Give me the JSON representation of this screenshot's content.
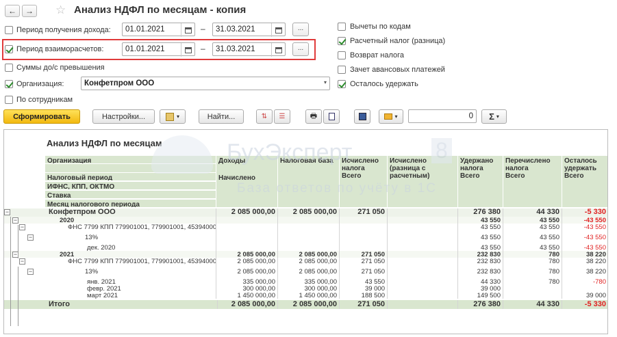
{
  "window": {
    "title": "Анализ НДФЛ по месяцам - копия",
    "back_icon": "←",
    "forward_icon": "→",
    "star_icon": "☆"
  },
  "filters": {
    "income_period": {
      "label": "Период получения дохода:",
      "checked": false,
      "from": "01.01.2021",
      "to": "31.03.2021"
    },
    "settlement_period": {
      "label": "Период взаиморасчетов:",
      "checked": true,
      "from": "01.01.2021",
      "to": "31.03.2021"
    },
    "sums_exceeding": {
      "label": "Суммы до/с превышения",
      "checked": false
    },
    "organization": {
      "label": "Организация:",
      "checked": true,
      "value": "Конфетпром ООО"
    },
    "by_employees": {
      "label": "По сотрудникам",
      "checked": false
    },
    "dash": "–",
    "dots": "..."
  },
  "options": [
    {
      "label": "Вычеты по кодам",
      "checked": false
    },
    {
      "label": "Расчетный налог (разница)",
      "checked": true
    },
    {
      "label": "Возврат налога",
      "checked": false
    },
    {
      "label": "Зачет авансовых платежей",
      "checked": false
    },
    {
      "label": "Осталось удержать",
      "checked": true
    }
  ],
  "toolbar": {
    "generate": "Сформировать",
    "settings": "Настройки...",
    "find": "Найти...",
    "sum_value": "0",
    "sigma": "Σ"
  },
  "watermark": {
    "brand": "БухЭксперт",
    "num": "8",
    "sub": "База ответов по учёту в 1С"
  },
  "report": {
    "title": "Анализ НДФЛ по месяцам",
    "headers": {
      "org": "Организация",
      "period": "Налоговый период",
      "ifns": "ИФНС, КПП, ОКТМО",
      "rate": "Ставка",
      "month": "Месяц налогового периода",
      "income": "Доходы",
      "income_sub": "Начислено",
      "base": "Налоговая база",
      "calc": "Исчислено налога",
      "calc_sub": "Всего",
      "calc_diff": "Исчислено (разница с расчетным)",
      "withheld": "Удержано налога",
      "withheld_sub": "Всего",
      "transferred": "Перечислено налога",
      "transferred_sub": "Всего",
      "left": "Осталось удержать",
      "left_sub": "Всего"
    },
    "rows": [
      {
        "name": "Конфетпром ООО",
        "income": "2 085 000,00",
        "base": "2 085 000,00",
        "calc": "271 050",
        "withheld": "276 380",
        "transferred": "44 330",
        "left": "-5 330"
      },
      {
        "name": "2020",
        "income": "",
        "base": "",
        "calc": "",
        "withheld": "43 550",
        "transferred": "43 550",
        "left": "-43 550"
      },
      {
        "name": "ФНС 7799 КПП 779901001, 779901001, 45394000",
        "income": "",
        "base": "",
        "calc": "",
        "withheld": "43 550",
        "transferred": "43 550",
        "left": "-43 550"
      },
      {
        "name": "13%",
        "income": "",
        "base": "",
        "calc": "",
        "withheld": "43 550",
        "transferred": "43 550",
        "left": "-43 550"
      },
      {
        "name": "дек. 2020",
        "income": "",
        "base": "",
        "calc": "",
        "withheld": "43 550",
        "transferred": "43 550",
        "left": "-43 550"
      },
      {
        "name": "2021",
        "income": "2 085 000,00",
        "base": "2 085 000,00",
        "calc": "271 050",
        "withheld": "232 830",
        "transferred": "780",
        "left": "38 220"
      },
      {
        "name": "ФНС 7799 КПП 779901001, 779901001, 45394000",
        "income": "2 085 000,00",
        "base": "2 085 000,00",
        "calc": "271 050",
        "withheld": "232 830",
        "transferred": "780",
        "left": "38 220"
      },
      {
        "name": "13%",
        "income": "2 085 000,00",
        "base": "2 085 000,00",
        "calc": "271 050",
        "withheld": "232 830",
        "transferred": "780",
        "left": "38 220"
      },
      {
        "name": "янв. 2021",
        "income": "335 000,00",
        "base": "335 000,00",
        "calc": "43 550",
        "withheld": "44 330",
        "transferred": "780",
        "left": "-780"
      },
      {
        "name": "февр. 2021",
        "income": "300 000,00",
        "base": "300 000,00",
        "calc": "39 000",
        "withheld": "39 000",
        "transferred": "",
        "left": ""
      },
      {
        "name": "март 2021",
        "income": "1 450 000,00",
        "base": "1 450 000,00",
        "calc": "188 500",
        "withheld": "149 500",
        "transferred": "",
        "left": "39 000"
      }
    ],
    "total": {
      "name": "Итого",
      "income": "2 085 000,00",
      "base": "2 085 000,00",
      "calc": "271 050",
      "withheld": "276 380",
      "transferred": "44 330",
      "left": "-5 330"
    }
  }
}
